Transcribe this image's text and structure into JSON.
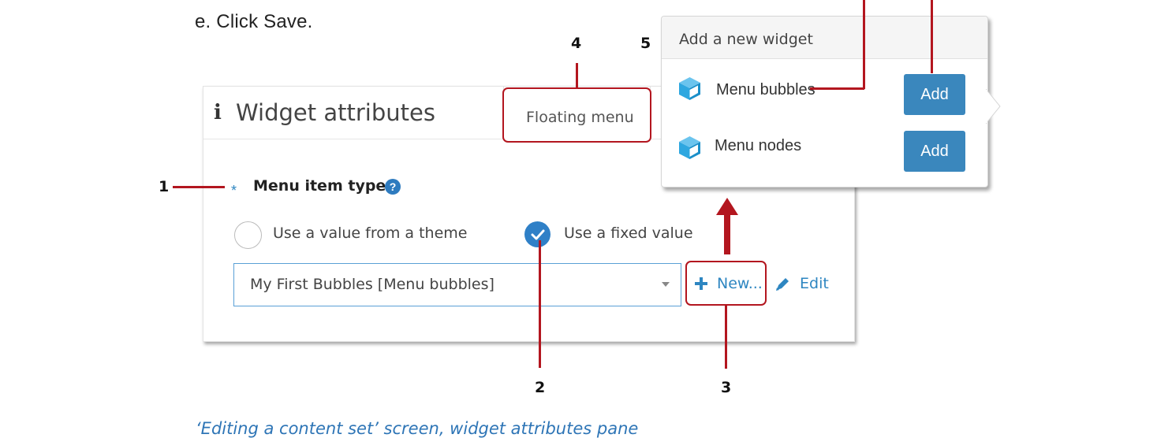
{
  "instruction": "e.  Click Save.",
  "callouts": [
    "1",
    "2",
    "3",
    "4",
    "5"
  ],
  "widget_panel": {
    "title": "Widget attributes",
    "tab_label": "Floating menu",
    "field_label": "Menu item type",
    "required_mark": "*",
    "help_glyph": "?",
    "options": [
      {
        "label": "Use a value from a theme",
        "selected": false
      },
      {
        "label": "Use a fixed value",
        "selected": true
      }
    ],
    "select_value": "My First Bubbles [Menu bubbles]",
    "new_label": "New...",
    "edit_label": "Edit"
  },
  "popup": {
    "title": "Add a new widget",
    "items": [
      {
        "label": "Menu bubbles",
        "button": "Add",
        "icon": "cube-icon"
      },
      {
        "label": "Menu nodes",
        "button": "Add",
        "icon": "cube-icon"
      }
    ]
  },
  "caption": "‘Editing a content set’ screen, widget attributes pane",
  "colors": {
    "accent": "#2e86c1",
    "button": "#3a87bd",
    "callout": "#b3161f"
  }
}
